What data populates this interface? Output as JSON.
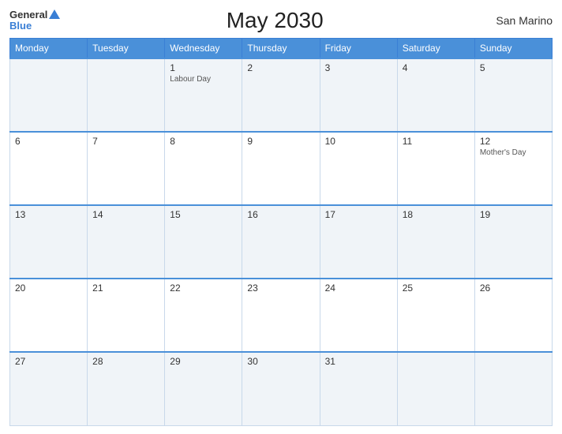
{
  "header": {
    "logo_general": "General",
    "logo_blue": "Blue",
    "title": "May 2030",
    "region": "San Marino"
  },
  "weekdays": [
    "Monday",
    "Tuesday",
    "Wednesday",
    "Thursday",
    "Friday",
    "Saturday",
    "Sunday"
  ],
  "weeks": [
    [
      {
        "day": "",
        "holiday": ""
      },
      {
        "day": "",
        "holiday": ""
      },
      {
        "day": "1",
        "holiday": "Labour Day"
      },
      {
        "day": "2",
        "holiday": ""
      },
      {
        "day": "3",
        "holiday": ""
      },
      {
        "day": "4",
        "holiday": ""
      },
      {
        "day": "5",
        "holiday": ""
      }
    ],
    [
      {
        "day": "6",
        "holiday": ""
      },
      {
        "day": "7",
        "holiday": ""
      },
      {
        "day": "8",
        "holiday": ""
      },
      {
        "day": "9",
        "holiday": ""
      },
      {
        "day": "10",
        "holiday": ""
      },
      {
        "day": "11",
        "holiday": ""
      },
      {
        "day": "12",
        "holiday": "Mother's Day"
      }
    ],
    [
      {
        "day": "13",
        "holiday": ""
      },
      {
        "day": "14",
        "holiday": ""
      },
      {
        "day": "15",
        "holiday": ""
      },
      {
        "day": "16",
        "holiday": ""
      },
      {
        "day": "17",
        "holiday": ""
      },
      {
        "day": "18",
        "holiday": ""
      },
      {
        "day": "19",
        "holiday": ""
      }
    ],
    [
      {
        "day": "20",
        "holiday": ""
      },
      {
        "day": "21",
        "holiday": ""
      },
      {
        "day": "22",
        "holiday": ""
      },
      {
        "day": "23",
        "holiday": ""
      },
      {
        "day": "24",
        "holiday": ""
      },
      {
        "day": "25",
        "holiday": ""
      },
      {
        "day": "26",
        "holiday": ""
      }
    ],
    [
      {
        "day": "27",
        "holiday": ""
      },
      {
        "day": "28",
        "holiday": ""
      },
      {
        "day": "29",
        "holiday": ""
      },
      {
        "day": "30",
        "holiday": ""
      },
      {
        "day": "31",
        "holiday": ""
      },
      {
        "day": "",
        "holiday": ""
      },
      {
        "day": "",
        "holiday": ""
      }
    ]
  ]
}
